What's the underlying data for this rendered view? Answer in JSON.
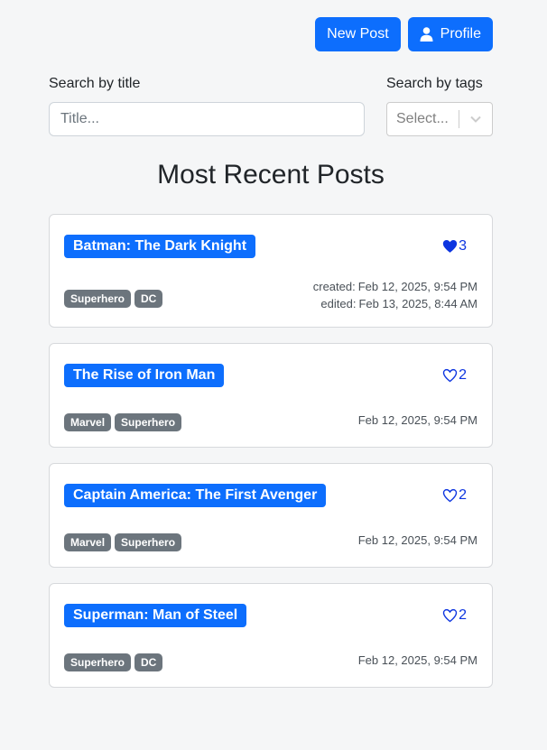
{
  "header": {
    "new_post_label": "New Post",
    "profile_label": "Profile"
  },
  "search": {
    "title_label": "Search by title",
    "title_placeholder": "Title...",
    "title_value": "",
    "tags_label": "Search by tags",
    "tags_placeholder": "Select..."
  },
  "section_title": "Most Recent Posts",
  "colors": {
    "primary": "#0d6efd",
    "tag": "#6c757d",
    "heart": "#0d35e0"
  },
  "posts": [
    {
      "title": "Batman: The Dark Knight",
      "likes": "3",
      "liked": true,
      "tags": [
        "Superhero",
        "DC"
      ],
      "created_label": "created:",
      "created": "Feb 12, 2025, 9:54 PM",
      "edited_label": "edited:",
      "edited": "Feb 13, 2025, 8:44 AM"
    },
    {
      "title": "The Rise of Iron Man",
      "likes": "2",
      "liked": false,
      "tags": [
        "Marvel",
        "Superhero"
      ],
      "date": "Feb 12, 2025, 9:54 PM"
    },
    {
      "title": "Captain America: The First Avenger",
      "likes": "2",
      "liked": false,
      "tags": [
        "Marvel",
        "Superhero"
      ],
      "date": "Feb 12, 2025, 9:54 PM"
    },
    {
      "title": "Superman: Man of Steel",
      "likes": "2",
      "liked": false,
      "tags": [
        "Superhero",
        "DC"
      ],
      "date": "Feb 12, 2025, 9:54 PM"
    }
  ]
}
